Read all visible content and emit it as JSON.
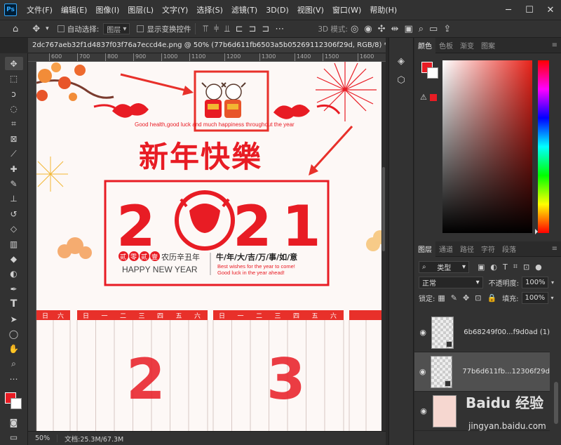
{
  "menu": {
    "items": [
      "文件(F)",
      "编辑(E)",
      "图像(I)",
      "图层(L)",
      "文字(Y)",
      "选择(S)",
      "滤镜(T)",
      "3D(D)",
      "视图(V)",
      "窗口(W)",
      "帮助(H)"
    ],
    "logo": "Ps"
  },
  "options": {
    "auto_select_label": "自动选择:",
    "auto_select_value": "图层",
    "show_transform_label": "显示变换控件",
    "mode_3d_label": "3D 模式:"
  },
  "document": {
    "tab_title": "2dc767aeb32f1d4837f03f76a7eccd4e.png @ 50% (77b6d611fb6503a5b05269112306f29d, RGB/8) *",
    "ruler_ticks": [
      "600",
      "700",
      "800",
      "900",
      "1000",
      "1100",
      "1200",
      "1300",
      "1400",
      "1500",
      "1600"
    ],
    "zoom": "50%",
    "doc_info": "文档:25.3M/67.3M"
  },
  "artwork": {
    "greeting_en": "Good health,good luck and much happiness throughout the year",
    "title_cn": "新年快樂",
    "year_digits": [
      "2",
      "2",
      "1"
    ],
    "pill_chars": [
      "贰",
      "零",
      "贰",
      "壹"
    ],
    "lunar_text": "农历辛丑年",
    "happy": "HAPPY NEW YEAR",
    "slogan_cn": "牛/年/大/吉/万/事/如/意",
    "wish1": "Best wishes for the year to come!",
    "wish2": "Good luck in the year ahead!",
    "cal_left_header": [
      "日",
      "六"
    ],
    "cal_mid_header": [
      "日",
      "一",
      "二",
      "三",
      "四",
      "五",
      "六"
    ],
    "cal_right_header": [
      "日",
      "一",
      "二",
      "三",
      "四",
      "五",
      "六"
    ],
    "big_month_2": "2",
    "big_month_3": "3"
  },
  "color_panel": {
    "tabs": [
      "颜色",
      "色板",
      "渐变",
      "图案"
    ],
    "fg_color": "#e81c24",
    "bg_color": "#ffffff"
  },
  "layers_panel": {
    "tabs": [
      "图层",
      "通道",
      "路径",
      "字符",
      "段落"
    ],
    "filter_label": "类型",
    "blend_mode": "正常",
    "opacity_label": "不透明度:",
    "opacity_value": "100%",
    "lock_label": "锁定:",
    "fill_label": "填充:",
    "fill_value": "100%",
    "layers": [
      {
        "name": "6b68249f00...f9d0ad (1)"
      },
      {
        "name": "77b6d611fb...12306f29d"
      },
      {
        "name": ""
      }
    ]
  },
  "watermark": {
    "text": "Baidu 经验",
    "url": "jingyan.baidu.com"
  }
}
